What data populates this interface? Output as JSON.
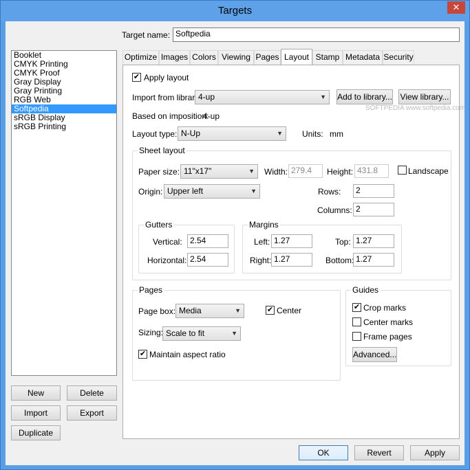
{
  "window": {
    "title": "Targets",
    "close_glyph": "✕"
  },
  "target_name": {
    "label": "Target name:",
    "value": "Softpedia"
  },
  "targets": {
    "items": [
      "Booklet",
      "CMYK Printing",
      "CMYK Proof",
      "Gray Display",
      "Gray Printing",
      "RGB Web",
      "Softpedia",
      "sRGB Display",
      "sRGB Printing"
    ],
    "selected_index": 6
  },
  "left_buttons": {
    "new": "New",
    "delete": "Delete",
    "import": "Import",
    "export": "Export",
    "duplicate": "Duplicate"
  },
  "tabs": [
    "Optimize",
    "Images",
    "Colors",
    "Viewing",
    "Pages",
    "Layout",
    "Stamp",
    "Metadata",
    "Security"
  ],
  "active_tab": "Layout",
  "layout": {
    "apply_layout": {
      "label": "Apply layout",
      "checked": true
    },
    "import_from_library": {
      "label": "Import from library:",
      "value": "4-up"
    },
    "add_to_library": "Add to library...",
    "view_library": "View library...",
    "based_on": {
      "label": "Based on imposition:",
      "value": "4-up"
    },
    "layout_type": {
      "label": "Layout type:",
      "value": "N-Up"
    },
    "units": {
      "label": "Units:",
      "value": "mm"
    },
    "watermark": "SOFTPEDIA  www.softpedia.com"
  },
  "sheet_layout": {
    "title": "Sheet layout",
    "paper_size": {
      "label": "Paper size:",
      "value": "11\"x17\""
    },
    "width": {
      "label": "Width:",
      "value": "279.4"
    },
    "height": {
      "label": "Height:",
      "value": "431.8"
    },
    "landscape": {
      "label": "Landscape",
      "checked": false
    },
    "origin": {
      "label": "Origin:",
      "value": "Upper left"
    },
    "rows": {
      "label": "Rows:",
      "value": "2"
    },
    "columns": {
      "label": "Columns:",
      "value": "2"
    },
    "gutters": {
      "title": "Gutters",
      "vertical_label": "Vertical:",
      "vertical": "2.54",
      "horizontal_label": "Horizontal:",
      "horizontal": "2.54"
    },
    "margins": {
      "title": "Margins",
      "left_label": "Left:",
      "left": "1.27",
      "right_label": "Right:",
      "right": "1.27",
      "top_label": "Top:",
      "top": "1.27",
      "bottom_label": "Bottom:",
      "bottom": "1.27"
    }
  },
  "pages": {
    "title": "Pages",
    "page_box": {
      "label": "Page box:",
      "value": "Media"
    },
    "center": {
      "label": "Center",
      "checked": true
    },
    "sizing": {
      "label": "Sizing:",
      "value": "Scale to fit"
    },
    "maintain_aspect": {
      "label": "Maintain aspect ratio",
      "checked": true
    }
  },
  "guides": {
    "title": "Guides",
    "crop_marks": {
      "label": "Crop marks",
      "checked": true
    },
    "center_marks": {
      "label": "Center marks",
      "checked": false
    },
    "frame_pages": {
      "label": "Frame pages",
      "checked": false
    },
    "advanced": "Advanced..."
  },
  "dialog_buttons": {
    "ok": "OK",
    "revert": "Revert",
    "apply": "Apply"
  },
  "glyphs": {
    "check": "✔",
    "dropdown": "▼"
  }
}
